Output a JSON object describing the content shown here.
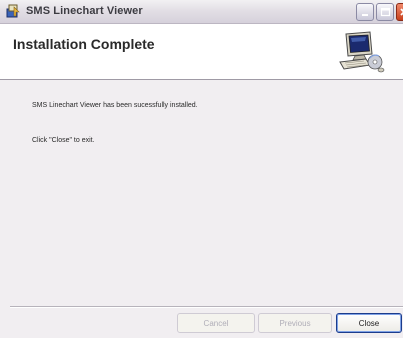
{
  "window": {
    "title": "SMS Linechart Viewer"
  },
  "banner": {
    "title": "Installation Complete",
    "graphic_icon": "computer-install-icon"
  },
  "body": {
    "message_line1": "SMS Linechart Viewer has been sucessfully installed.",
    "message_line2": "Click \"Close\" to exit."
  },
  "buttons": {
    "cancel_label": "Cancel",
    "previous_label": "Previous",
    "close_label": "Close"
  },
  "colors": {
    "close_button_border": "#1c3c8c",
    "titlebar_close": "#c8401d"
  }
}
